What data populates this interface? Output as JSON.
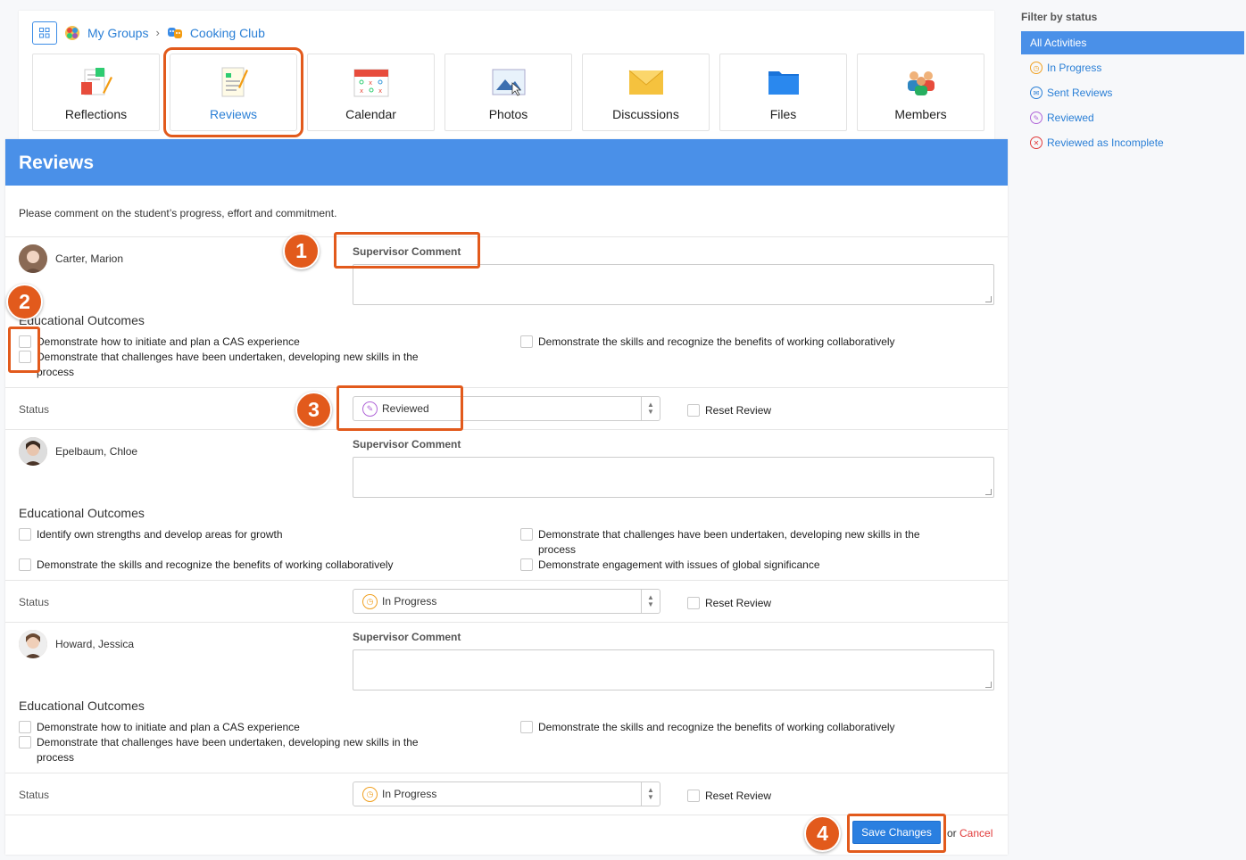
{
  "breadcrumb": {
    "my_groups": "My Groups",
    "group": "Cooking Club"
  },
  "tiles": [
    {
      "label": "Reflections",
      "icon": "reflections-icon"
    },
    {
      "label": "Reviews",
      "icon": "reviews-icon",
      "active": true
    },
    {
      "label": "Calendar",
      "icon": "calendar-icon"
    },
    {
      "label": "Photos",
      "icon": "photos-icon"
    },
    {
      "label": "Discussions",
      "icon": "discussions-icon"
    },
    {
      "label": "Files",
      "icon": "files-icon"
    },
    {
      "label": "Members",
      "icon": "members-icon"
    }
  ],
  "panel": {
    "title": "Reviews",
    "intro": "Please comment on the student’s progress, effort and commitment.",
    "supervisor_comment_label": "Supervisor Comment",
    "educational_outcomes_label": "Educational Outcomes",
    "status_label": "Status",
    "reset_review_label": "Reset Review"
  },
  "students": [
    {
      "name": "Carter, Marion",
      "status": "Reviewed",
      "outcomes": [
        "Demonstrate how to initiate and plan a CAS experience",
        "Demonstrate that challenges have been undertaken, developing new skills in the process",
        "Demonstrate the skills and recognize the benefits of working collaboratively"
      ]
    },
    {
      "name": "Epelbaum, Chloe",
      "status": "In Progress",
      "outcomes": [
        "Identify own strengths and develop areas for growth",
        "Demonstrate the skills and recognize the benefits of working collaboratively",
        "Demonstrate that challenges have been undertaken, developing new skills in the process",
        "Demonstrate engagement with issues of global significance"
      ]
    },
    {
      "name": "Howard, Jessica",
      "status": "In Progress",
      "outcomes": [
        "Demonstrate how to initiate and plan a CAS experience",
        "Demonstrate that challenges have been undertaken, developing new skills in the process",
        "Demonstrate the skills and recognize the benefits of working collaboratively"
      ]
    }
  ],
  "footer": {
    "save": "Save Changes",
    "or": "or",
    "cancel": "Cancel"
  },
  "callouts": [
    "1",
    "2",
    "3",
    "4"
  ],
  "filter": {
    "title": "Filter by status",
    "items": [
      "All Activities",
      "In Progress",
      "Sent Reviews",
      "Reviewed",
      "Reviewed as Incomplete"
    ]
  },
  "colors": {
    "accent": "#4a90e8",
    "callout": "#e25a1c",
    "in_progress": "#f0a020",
    "reviewed": "#b066d8",
    "incomplete": "#e13a3a"
  }
}
